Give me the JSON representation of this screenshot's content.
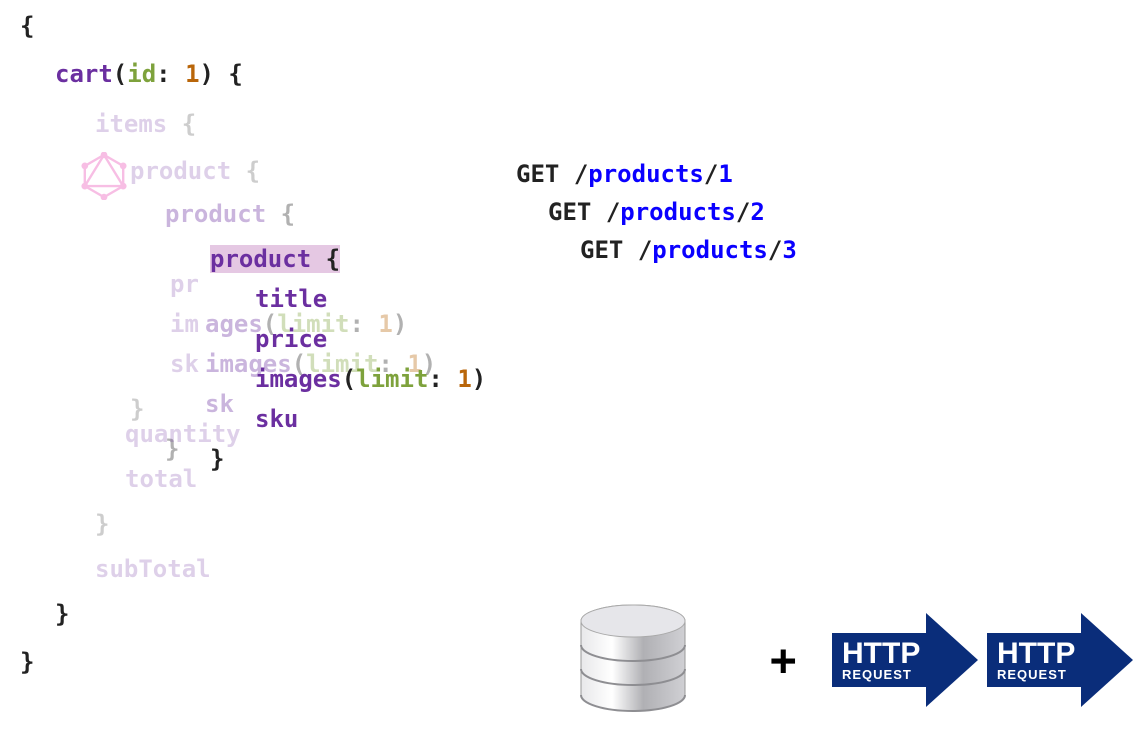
{
  "query": {
    "cart_fn": "cart",
    "cart_arg": "id",
    "cart_val": "1",
    "items": "items",
    "product": "product",
    "title": "title",
    "price": "price",
    "images_fn": "images",
    "images_arg": "limit",
    "images_val": "1",
    "sku": "sku",
    "quantity": "quantity",
    "total": "total",
    "subTotal": "subTotal",
    "brace_open": "{",
    "brace_close": "}",
    "paren_open": "(",
    "paren_close": ")",
    "colon": ":"
  },
  "http": {
    "get": "GET",
    "slash": "/",
    "path": "products",
    "ids": [
      "1",
      "2",
      "3"
    ]
  },
  "httpArrowLabelTop": "HTTP",
  "httpArrowLabelBottom": "REQUEST",
  "plus": "+"
}
